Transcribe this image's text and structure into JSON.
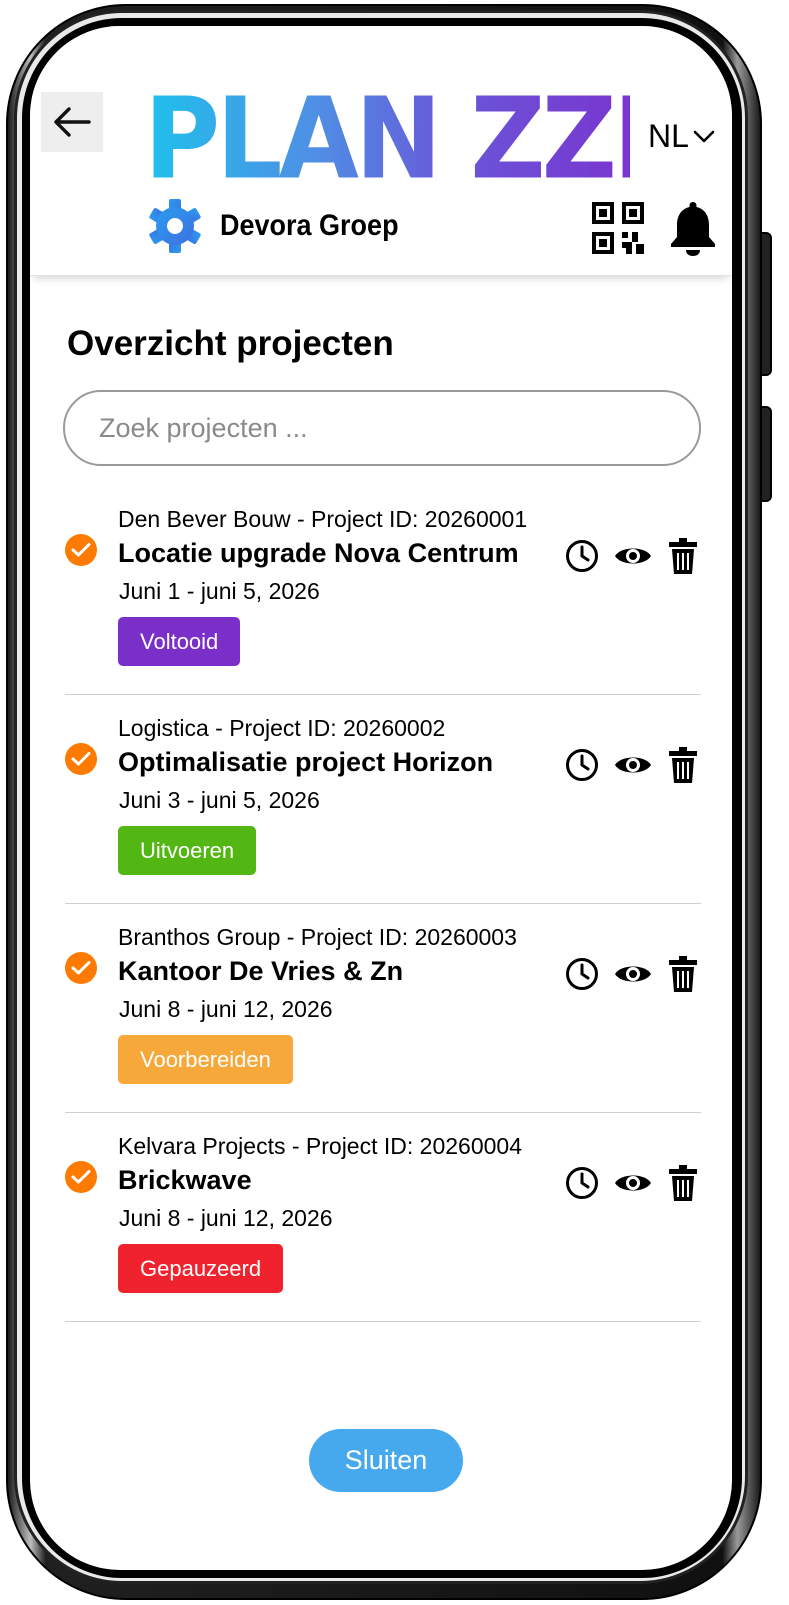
{
  "header": {
    "logo_text": "PLAN ZZP",
    "language": "NL",
    "company_name": "Devora Groep"
  },
  "colors": {
    "accent_orange": "#ff7a00",
    "button_blue": "#46a9ee",
    "status_done": "#7b2fc9",
    "status_running": "#52b613",
    "status_prep": "#f7a83a",
    "status_paused": "#f0222d"
  },
  "main": {
    "title": "Overzicht projecten",
    "search_placeholder": "Zoek projecten ...",
    "projects": [
      {
        "client": "Den Bever Bouw - Project ID: 20260001",
        "name": "Locatie upgrade Nova Centrum",
        "dates": "Juni 1 - juni 5, 2026",
        "status": "Voltooid",
        "status_color": "#7b2fc9"
      },
      {
        "client": "Logistica - Project ID: 20260002",
        "name": "Optimalisatie project Horizon",
        "dates": "Juni 3 - juni 5, 2026",
        "status": "Uitvoeren",
        "status_color": "#52b613"
      },
      {
        "client": "Branthos Group - Project ID: 20260003",
        "name": "Kantoor De Vries & Zn",
        "dates": "Juni 8 - juni 12, 2026",
        "status": "Voorbereiden",
        "status_color": "#f7a83a"
      },
      {
        "client": "Kelvara Projects - Project ID: 20260004",
        "name": "Brickwave",
        "dates": "Juni 8 - juni 12, 2026",
        "status": "Gepauzeerd",
        "status_color": "#f0222d"
      }
    ],
    "close_label": "Sluiten"
  }
}
